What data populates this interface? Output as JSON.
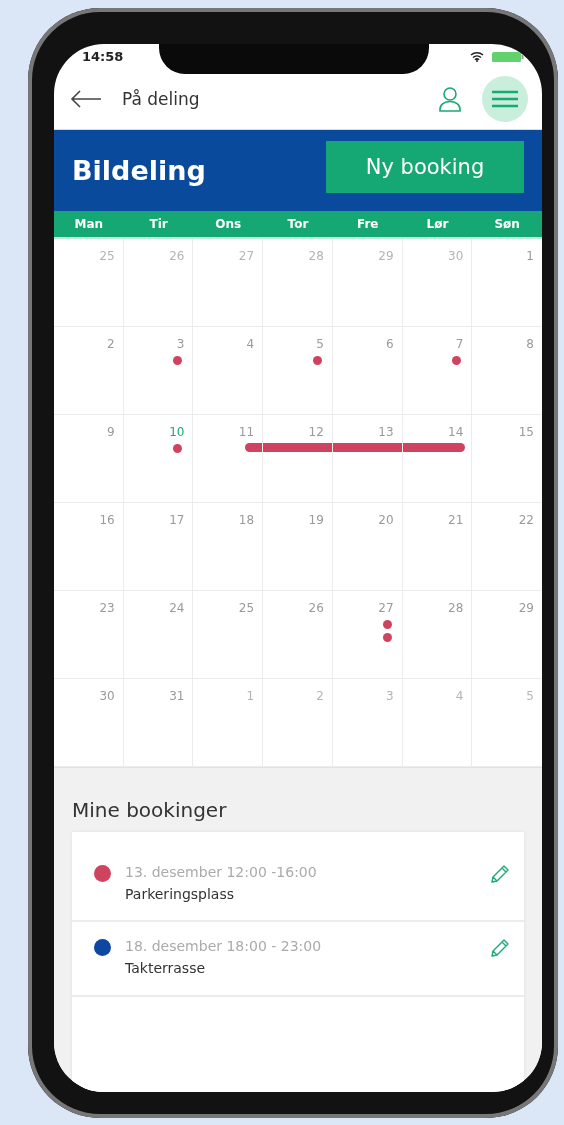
{
  "status_bar": {
    "time": "14:58"
  },
  "header": {
    "title": "På deling"
  },
  "banner": {
    "title": "Bildeling",
    "button": "Ny booking"
  },
  "calendar": {
    "weekdays": [
      "Man",
      "Tir",
      "Ons",
      "Tor",
      "Fre",
      "Lør",
      "Søn"
    ],
    "weeks": [
      [
        {
          "day": "25",
          "muted": true,
          "today": false,
          "booked": false
        },
        {
          "day": "26",
          "muted": true,
          "today": false,
          "booked": false
        },
        {
          "day": "27",
          "muted": true,
          "today": false,
          "booked": false
        },
        {
          "day": "28",
          "muted": true,
          "today": false,
          "booked": false
        },
        {
          "day": "29",
          "muted": true,
          "today": false,
          "booked": false
        },
        {
          "day": "30",
          "muted": true,
          "today": false,
          "booked": false
        },
        {
          "day": "1",
          "muted": false,
          "today": false,
          "booked": false
        }
      ],
      [
        {
          "day": "2",
          "muted": false,
          "today": false,
          "booked": false
        },
        {
          "day": "3",
          "muted": false,
          "today": false,
          "booked": false,
          "dots": [
            {
              "color": "#d0435f"
            }
          ]
        },
        {
          "day": "4",
          "muted": false,
          "today": false,
          "booked": false
        },
        {
          "day": "5",
          "muted": false,
          "today": false,
          "booked": false,
          "dots": [
            {
              "color": "#d0435f"
            }
          ]
        },
        {
          "day": "6",
          "muted": false,
          "today": false,
          "booked": false
        },
        {
          "day": "7",
          "muted": false,
          "today": false,
          "booked": false,
          "dots": [
            {
              "color": "#d0435f"
            }
          ]
        },
        {
          "day": "8",
          "muted": false,
          "today": false,
          "booked": false
        }
      ],
      [
        {
          "day": "9",
          "muted": false,
          "today": false,
          "booked": false
        },
        {
          "day": "10",
          "muted": false,
          "today": true,
          "booked": false,
          "dots": [
            {
              "color": "#d0435f"
            }
          ]
        },
        {
          "day": "11",
          "muted": false,
          "today": false,
          "booked": true
        },
        {
          "day": "12",
          "muted": false,
          "today": false,
          "booked": true
        },
        {
          "day": "13",
          "muted": false,
          "today": false,
          "booked": true
        },
        {
          "day": "14",
          "muted": false,
          "today": false,
          "booked": true
        },
        {
          "day": "15",
          "muted": false,
          "today": false,
          "booked": false
        }
      ],
      [
        {
          "day": "16",
          "muted": false,
          "today": false,
          "booked": false
        },
        {
          "day": "17",
          "muted": false,
          "today": false,
          "booked": false
        },
        {
          "day": "18",
          "muted": false,
          "today": false,
          "booked": false
        },
        {
          "day": "19",
          "muted": false,
          "today": false,
          "booked": false
        },
        {
          "day": "20",
          "muted": false,
          "today": false,
          "booked": false
        },
        {
          "day": "21",
          "muted": false,
          "today": false,
          "booked": false
        },
        {
          "day": "22",
          "muted": false,
          "today": false,
          "booked": false
        }
      ],
      [
        {
          "day": "23",
          "muted": false,
          "today": false,
          "booked": false
        },
        {
          "day": "24",
          "muted": false,
          "today": false,
          "booked": false
        },
        {
          "day": "25",
          "muted": false,
          "today": false,
          "booked": false
        },
        {
          "day": "26",
          "muted": false,
          "today": false,
          "booked": false
        },
        {
          "day": "27",
          "muted": false,
          "today": false,
          "booked": false,
          "dots": [
            {
              "color": "#d0435f"
            },
            {
              "color": "#d0435f"
            }
          ]
        },
        {
          "day": "28",
          "muted": false,
          "today": false,
          "booked": false
        },
        {
          "day": "29",
          "muted": false,
          "today": false,
          "booked": false
        }
      ],
      [
        {
          "day": "30",
          "muted": false,
          "today": false,
          "booked": false
        },
        {
          "day": "31",
          "muted": false,
          "today": false,
          "booked": false
        },
        {
          "day": "1",
          "muted": true,
          "today": false,
          "booked": false
        },
        {
          "day": "2",
          "muted": true,
          "today": false,
          "booked": false
        },
        {
          "day": "3",
          "muted": true,
          "today": false,
          "booked": false
        },
        {
          "day": "4",
          "muted": true,
          "today": false,
          "booked": false
        },
        {
          "day": "5",
          "muted": true,
          "today": false,
          "booked": false
        }
      ]
    ]
  },
  "bookings": {
    "title": "Mine bookinger",
    "items": [
      {
        "color": "#d0435f",
        "time": "13. desember 12:00 -16:00",
        "place": "Parkeringsplass"
      },
      {
        "color": "#0d47a1",
        "time": "18. desember 18:00 - 23:00",
        "place": "Takterrasse"
      }
    ]
  }
}
